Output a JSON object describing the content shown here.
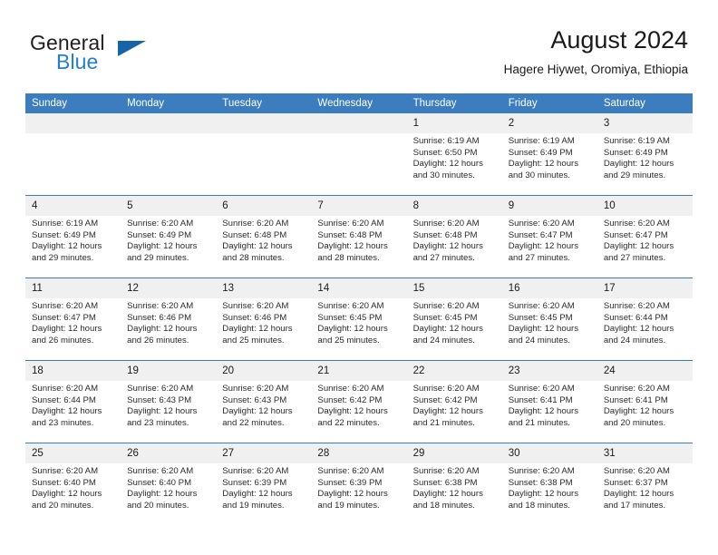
{
  "brand": {
    "name_top": "General",
    "name_bottom": "Blue",
    "logo_icon": "blue-triangle-icon",
    "color_blue": "#1f7fd0",
    "color_triangle": "#1664a8"
  },
  "header": {
    "title": "August 2024",
    "subtitle": "Hagere Hiywet, Oromiya, Ethiopia"
  },
  "calendar": {
    "accent_color": "#3b7dbf",
    "daynum_band_color": "#f0f0f0",
    "weekday_headers": [
      "Sunday",
      "Monday",
      "Tuesday",
      "Wednesday",
      "Thursday",
      "Friday",
      "Saturday"
    ],
    "weeks": [
      [
        {
          "day": "",
          "empty": true
        },
        {
          "day": "",
          "empty": true
        },
        {
          "day": "",
          "empty": true
        },
        {
          "day": "",
          "empty": true
        },
        {
          "day": "1",
          "sunrise": "Sunrise: 6:19 AM",
          "sunset": "Sunset: 6:50 PM",
          "daylight_1": "Daylight: 12 hours",
          "daylight_2": "and 30 minutes."
        },
        {
          "day": "2",
          "sunrise": "Sunrise: 6:19 AM",
          "sunset": "Sunset: 6:49 PM",
          "daylight_1": "Daylight: 12 hours",
          "daylight_2": "and 30 minutes."
        },
        {
          "day": "3",
          "sunrise": "Sunrise: 6:19 AM",
          "sunset": "Sunset: 6:49 PM",
          "daylight_1": "Daylight: 12 hours",
          "daylight_2": "and 29 minutes."
        }
      ],
      [
        {
          "day": "4",
          "sunrise": "Sunrise: 6:19 AM",
          "sunset": "Sunset: 6:49 PM",
          "daylight_1": "Daylight: 12 hours",
          "daylight_2": "and 29 minutes."
        },
        {
          "day": "5",
          "sunrise": "Sunrise: 6:20 AM",
          "sunset": "Sunset: 6:49 PM",
          "daylight_1": "Daylight: 12 hours",
          "daylight_2": "and 29 minutes."
        },
        {
          "day": "6",
          "sunrise": "Sunrise: 6:20 AM",
          "sunset": "Sunset: 6:48 PM",
          "daylight_1": "Daylight: 12 hours",
          "daylight_2": "and 28 minutes."
        },
        {
          "day": "7",
          "sunrise": "Sunrise: 6:20 AM",
          "sunset": "Sunset: 6:48 PM",
          "daylight_1": "Daylight: 12 hours",
          "daylight_2": "and 28 minutes."
        },
        {
          "day": "8",
          "sunrise": "Sunrise: 6:20 AM",
          "sunset": "Sunset: 6:48 PM",
          "daylight_1": "Daylight: 12 hours",
          "daylight_2": "and 27 minutes."
        },
        {
          "day": "9",
          "sunrise": "Sunrise: 6:20 AM",
          "sunset": "Sunset: 6:47 PM",
          "daylight_1": "Daylight: 12 hours",
          "daylight_2": "and 27 minutes."
        },
        {
          "day": "10",
          "sunrise": "Sunrise: 6:20 AM",
          "sunset": "Sunset: 6:47 PM",
          "daylight_1": "Daylight: 12 hours",
          "daylight_2": "and 27 minutes."
        }
      ],
      [
        {
          "day": "11",
          "sunrise": "Sunrise: 6:20 AM",
          "sunset": "Sunset: 6:47 PM",
          "daylight_1": "Daylight: 12 hours",
          "daylight_2": "and 26 minutes."
        },
        {
          "day": "12",
          "sunrise": "Sunrise: 6:20 AM",
          "sunset": "Sunset: 6:46 PM",
          "daylight_1": "Daylight: 12 hours",
          "daylight_2": "and 26 minutes."
        },
        {
          "day": "13",
          "sunrise": "Sunrise: 6:20 AM",
          "sunset": "Sunset: 6:46 PM",
          "daylight_1": "Daylight: 12 hours",
          "daylight_2": "and 25 minutes."
        },
        {
          "day": "14",
          "sunrise": "Sunrise: 6:20 AM",
          "sunset": "Sunset: 6:45 PM",
          "daylight_1": "Daylight: 12 hours",
          "daylight_2": "and 25 minutes."
        },
        {
          "day": "15",
          "sunrise": "Sunrise: 6:20 AM",
          "sunset": "Sunset: 6:45 PM",
          "daylight_1": "Daylight: 12 hours",
          "daylight_2": "and 24 minutes."
        },
        {
          "day": "16",
          "sunrise": "Sunrise: 6:20 AM",
          "sunset": "Sunset: 6:45 PM",
          "daylight_1": "Daylight: 12 hours",
          "daylight_2": "and 24 minutes."
        },
        {
          "day": "17",
          "sunrise": "Sunrise: 6:20 AM",
          "sunset": "Sunset: 6:44 PM",
          "daylight_1": "Daylight: 12 hours",
          "daylight_2": "and 24 minutes."
        }
      ],
      [
        {
          "day": "18",
          "sunrise": "Sunrise: 6:20 AM",
          "sunset": "Sunset: 6:44 PM",
          "daylight_1": "Daylight: 12 hours",
          "daylight_2": "and 23 minutes."
        },
        {
          "day": "19",
          "sunrise": "Sunrise: 6:20 AM",
          "sunset": "Sunset: 6:43 PM",
          "daylight_1": "Daylight: 12 hours",
          "daylight_2": "and 23 minutes."
        },
        {
          "day": "20",
          "sunrise": "Sunrise: 6:20 AM",
          "sunset": "Sunset: 6:43 PM",
          "daylight_1": "Daylight: 12 hours",
          "daylight_2": "and 22 minutes."
        },
        {
          "day": "21",
          "sunrise": "Sunrise: 6:20 AM",
          "sunset": "Sunset: 6:42 PM",
          "daylight_1": "Daylight: 12 hours",
          "daylight_2": "and 22 minutes."
        },
        {
          "day": "22",
          "sunrise": "Sunrise: 6:20 AM",
          "sunset": "Sunset: 6:42 PM",
          "daylight_1": "Daylight: 12 hours",
          "daylight_2": "and 21 minutes."
        },
        {
          "day": "23",
          "sunrise": "Sunrise: 6:20 AM",
          "sunset": "Sunset: 6:41 PM",
          "daylight_1": "Daylight: 12 hours",
          "daylight_2": "and 21 minutes."
        },
        {
          "day": "24",
          "sunrise": "Sunrise: 6:20 AM",
          "sunset": "Sunset: 6:41 PM",
          "daylight_1": "Daylight: 12 hours",
          "daylight_2": "and 20 minutes."
        }
      ],
      [
        {
          "day": "25",
          "sunrise": "Sunrise: 6:20 AM",
          "sunset": "Sunset: 6:40 PM",
          "daylight_1": "Daylight: 12 hours",
          "daylight_2": "and 20 minutes."
        },
        {
          "day": "26",
          "sunrise": "Sunrise: 6:20 AM",
          "sunset": "Sunset: 6:40 PM",
          "daylight_1": "Daylight: 12 hours",
          "daylight_2": "and 20 minutes."
        },
        {
          "day": "27",
          "sunrise": "Sunrise: 6:20 AM",
          "sunset": "Sunset: 6:39 PM",
          "daylight_1": "Daylight: 12 hours",
          "daylight_2": "and 19 minutes."
        },
        {
          "day": "28",
          "sunrise": "Sunrise: 6:20 AM",
          "sunset": "Sunset: 6:39 PM",
          "daylight_1": "Daylight: 12 hours",
          "daylight_2": "and 19 minutes."
        },
        {
          "day": "29",
          "sunrise": "Sunrise: 6:20 AM",
          "sunset": "Sunset: 6:38 PM",
          "daylight_1": "Daylight: 12 hours",
          "daylight_2": "and 18 minutes."
        },
        {
          "day": "30",
          "sunrise": "Sunrise: 6:20 AM",
          "sunset": "Sunset: 6:38 PM",
          "daylight_1": "Daylight: 12 hours",
          "daylight_2": "and 18 minutes."
        },
        {
          "day": "31",
          "sunrise": "Sunrise: 6:20 AM",
          "sunset": "Sunset: 6:37 PM",
          "daylight_1": "Daylight: 12 hours",
          "daylight_2": "and 17 minutes."
        }
      ]
    ]
  }
}
